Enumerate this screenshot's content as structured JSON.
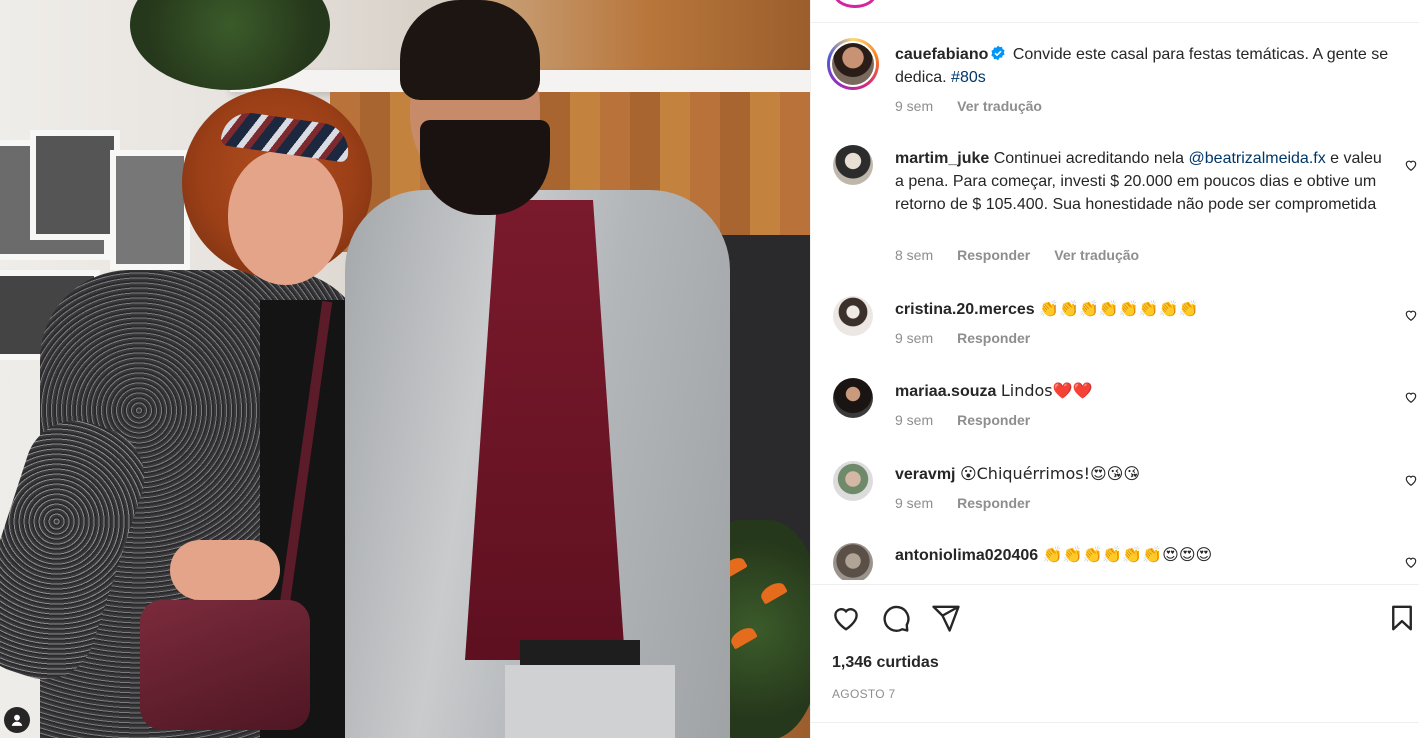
{
  "post": {
    "author": "cauefabiano",
    "caption": "Convide este casal para festas temáticas. A gente se dedica.",
    "hashtag": "#80s",
    "age": "9 sem",
    "translate_label": "Ver tradução"
  },
  "comments": [
    {
      "user": "martim_juke",
      "text_before": "Continuei acreditando nela ",
      "mention": "@beatrizalmeida.fx",
      "text_after": " e valeu a pena. Para começar, investi $ 20.000 em poucos dias e obtive um retorno de $ 105.400. Sua honestidade não pode ser comprometida",
      "age": "8 sem",
      "reply": "Responder",
      "translate": "Ver tradução"
    },
    {
      "user": "cristina.20.merces",
      "text": "👏👏👏👏👏👏👏👏",
      "age": "9 sem",
      "reply": "Responder"
    },
    {
      "user": "mariaa.souza",
      "text": "Lindos❤️❤️",
      "age": "9 sem",
      "reply": "Responder"
    },
    {
      "user": "veravmj",
      "text": "😮Chiquérrimos!😍😘😘",
      "age": "9 sem",
      "reply": "Responder"
    },
    {
      "user": "antoniolima020406",
      "text": "👏👏👏👏👏👏😍😍😍",
      "age": "",
      "reply": ""
    }
  ],
  "footer": {
    "likes": "1,346 curtidas",
    "date": "AGOSTO 7"
  },
  "icons": {
    "like": "heart-icon",
    "comment": "comment-icon",
    "share": "share-icon",
    "save": "bookmark-icon",
    "verified": "verified-badge-icon",
    "profile": "user-icon"
  },
  "colors": {
    "link": "#00376b",
    "muted": "#8e8e8e",
    "verified": "#0095f6"
  }
}
